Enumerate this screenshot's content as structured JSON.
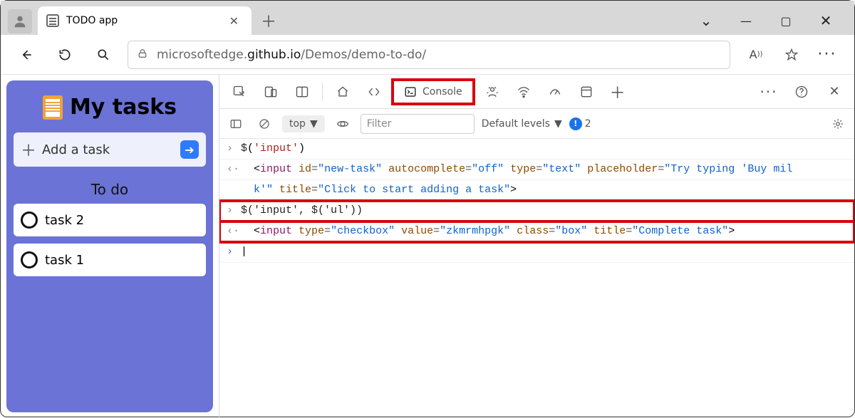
{
  "tab": {
    "title": "TODO app"
  },
  "url": {
    "host_left": "microsoftedge.",
    "host_dark": "github.io",
    "path": "/Demos/demo-to-do/"
  },
  "page": {
    "title": "My tasks",
    "add_placeholder": "Add a task",
    "section": "To do",
    "tasks": [
      "task 2",
      "task 1"
    ]
  },
  "devtools": {
    "console_tab": "Console",
    "context": "top",
    "filter_placeholder": "Filter",
    "levels": "Default levels",
    "issues_count": "2"
  },
  "console": {
    "line1_call": "$",
    "line1_arg": "'input'",
    "line2_tag": "input",
    "line2_attrs": [
      {
        "n": "id",
        "v": "\"new-task\""
      },
      {
        "n": "autocomplete",
        "v": "\"off\""
      },
      {
        "n": "type",
        "v": "\"text\""
      },
      {
        "n": "placeholder",
        "v": "\"Try typing 'Buy mil"
      }
    ],
    "line2b_attrs": [
      {
        "pre": "k'\"",
        "n": "title",
        "v": "\"Click to start adding a task\""
      }
    ],
    "line3": "$('input', $('ul'))",
    "line4_tag": "input",
    "line4_attrs": [
      {
        "n": "type",
        "v": "\"checkbox\""
      },
      {
        "n": "value",
        "v": "\"zkmrmhpgk\""
      },
      {
        "n": "class",
        "v": "\"box\""
      },
      {
        "n": "title",
        "v": "\"Complete task\""
      }
    ]
  }
}
